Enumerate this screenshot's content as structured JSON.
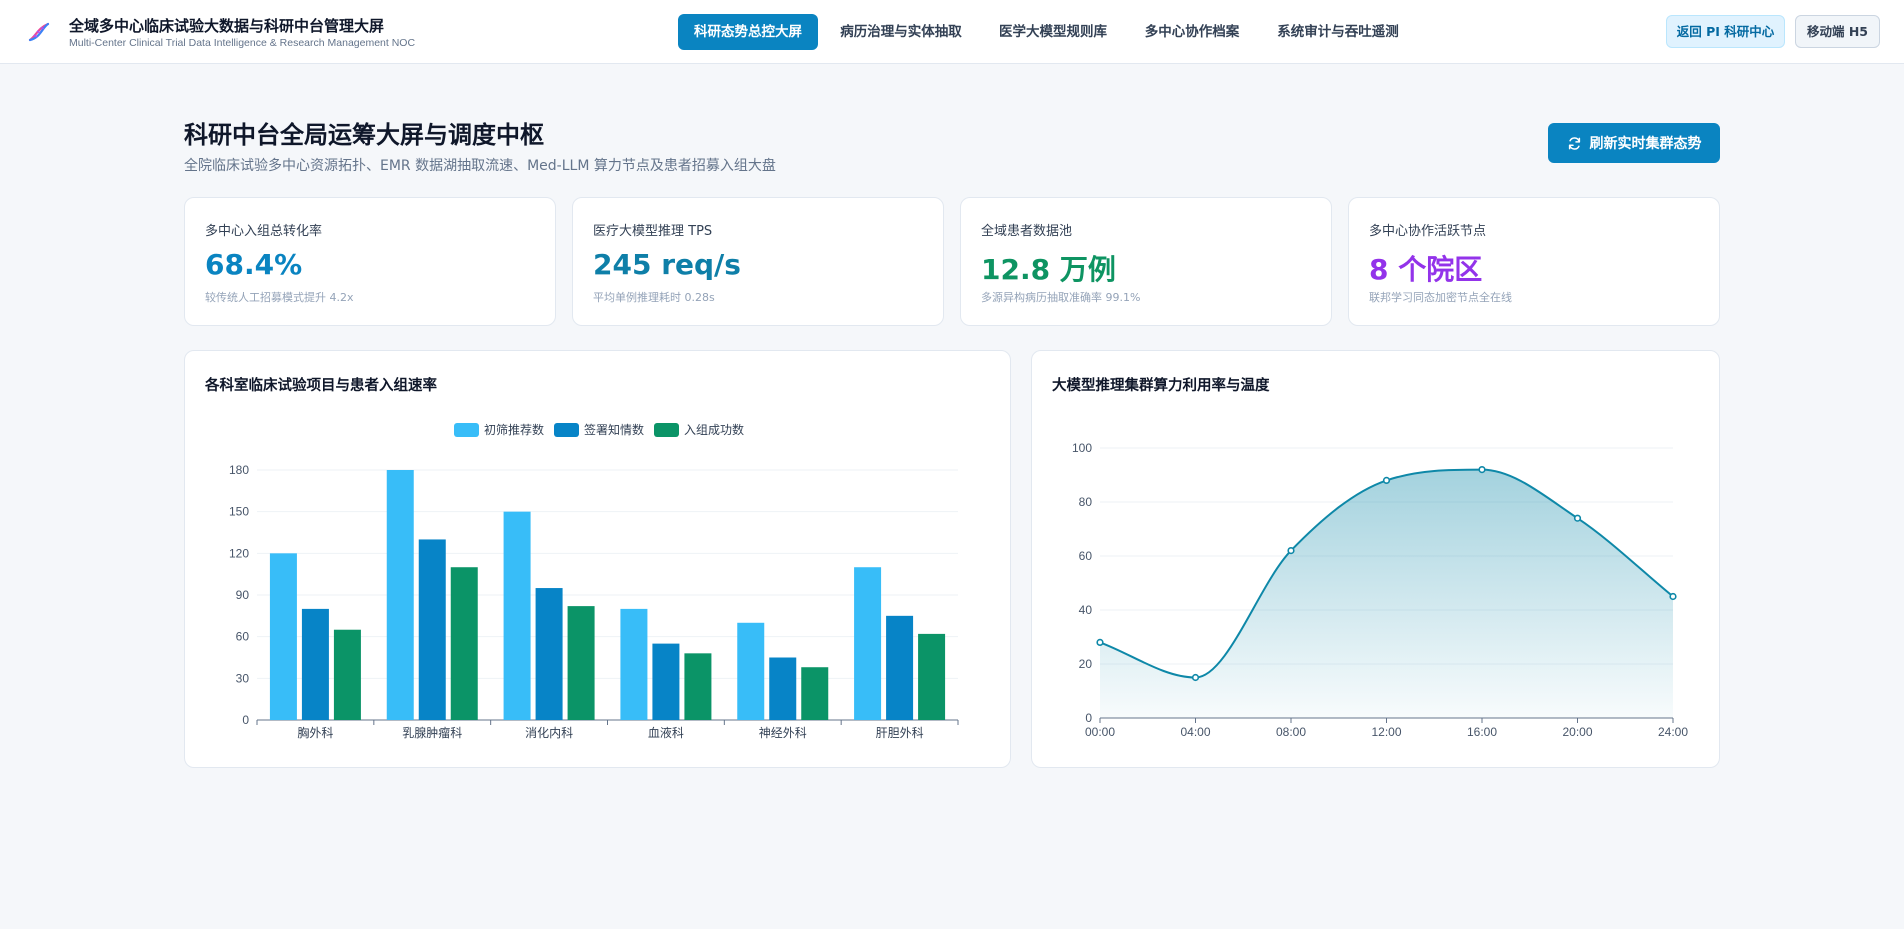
{
  "header": {
    "title": "全域多中心临床试验大数据与科研中台管理大屏",
    "subtitle": "Multi-Center Clinical Trial Data Intelligence & Research Management NOC",
    "logo_icon": "dna-icon"
  },
  "nav": {
    "tabs": [
      {
        "label": "科研态势总控大屏",
        "active": true
      },
      {
        "label": "病历治理与实体抽取",
        "active": false
      },
      {
        "label": "医学大模型规则库",
        "active": false
      },
      {
        "label": "多中心协作档案",
        "active": false
      },
      {
        "label": "系统审计与吞吐遥测",
        "active": false
      }
    ]
  },
  "actions": {
    "pi_center": "返回 PI 科研中心",
    "mobile": "移动端 H5"
  },
  "page": {
    "title": "科研中台全局运筹大屏与调度中枢",
    "subtitle": "全院临床试验多中心资源拓扑、EMR 数据湖抽取流速、Med-LLM 算力节点及患者招募入组大盘",
    "refresh_label": "刷新实时集群态势",
    "refresh_icon": "refresh-icon"
  },
  "kpis": [
    {
      "label": "多中心入组总转化率",
      "value": "68.4%",
      "note": "较传统人工招募模式提升 4.2x",
      "color": "#0a84c1"
    },
    {
      "label": "医疗大模型推理 TPS",
      "value": "245 req/s",
      "note": "平均单例推理耗时 0.28s",
      "color": "#0e7fa8"
    },
    {
      "label": "全域患者数据池",
      "value": "12.8 万例",
      "note": "多源异构病历抽取准确率 99.1%",
      "color": "#0e9462"
    },
    {
      "label": "多中心协作活跃节点",
      "value": "8 个院区",
      "note": "联邦学习同态加密节点全在线",
      "color": "#9333ea"
    }
  ],
  "panels": {
    "bar_title": "各科室临床试验项目与患者入组速率",
    "line_title": "大模型推理集群算力利用率与温度"
  },
  "chart_data": [
    {
      "type": "bar",
      "title": "各科室临床试验项目与患者入组速率",
      "categories": [
        "胸外科",
        "乳腺肿瘤科",
        "消化内科",
        "血液科",
        "神经外科",
        "肝胆外科"
      ],
      "series": [
        {
          "name": "初筛推荐数",
          "color": "#38bdf8",
          "values": [
            120,
            180,
            150,
            80,
            70,
            110
          ]
        },
        {
          "name": "签署知情数",
          "color": "#0784c7",
          "values": [
            80,
            130,
            95,
            55,
            45,
            75
          ]
        },
        {
          "name": "入组成功数",
          "color": "#0b9467",
          "values": [
            65,
            110,
            82,
            48,
            38,
            62
          ]
        }
      ],
      "ylim": [
        0,
        180
      ],
      "yticks": [
        0,
        30,
        60,
        90,
        120,
        150,
        180
      ],
      "legend": "top-center",
      "grid": true
    },
    {
      "type": "area",
      "title": "大模型推理集群算力利用率与温度",
      "x": [
        "00:00",
        "04:00",
        "08:00",
        "12:00",
        "16:00",
        "20:00",
        "24:00"
      ],
      "series": [
        {
          "color": "#0e88a8",
          "values": [
            28,
            15,
            62,
            88,
            92,
            74,
            45
          ]
        }
      ],
      "ylim": [
        0,
        100
      ],
      "yticks": [
        0,
        20,
        40,
        60,
        80,
        100
      ],
      "grid": true,
      "smooth": true
    }
  ]
}
